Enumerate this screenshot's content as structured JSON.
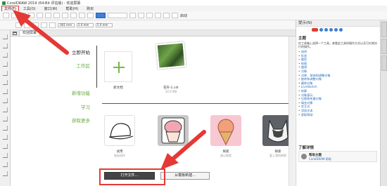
{
  "window": {
    "title": "CorelDRAW 2019 (64-Bit 评估版) - 欢迎屏幕"
  },
  "menu": {
    "file": "文件(F)",
    "tools": "工具(O)",
    "window": "窗口(W)",
    "help": "帮助(H)",
    "buy": "购买"
  },
  "toolbar": {
    "launch": "启动",
    "size1": "5.0 mm",
    "size2": "5.0 mm",
    "outline": ".001 mm"
  },
  "tabs": {
    "welcome": "欢迎屏幕"
  },
  "nav": {
    "items": [
      "立即开始",
      "工作区",
      "新增功能",
      "学习",
      "获取更多"
    ]
  },
  "recent": {
    "new_doc": "新文档",
    "file_name": "花卉-1.cdr",
    "file_size": "32.6 MB"
  },
  "templates": [
    {
      "title": "试用",
      "sub": "轻松创作"
    },
    {
      "title": "",
      "sub": ""
    },
    {
      "title": "探索",
      "sub": "甜心图案"
    },
    {
      "title": "探索",
      "sub": "爱上我的狗狗"
    }
  ],
  "buttons": {
    "open": "打开文件...",
    "new_from_template": "从模板新建..."
  },
  "panel": {
    "title": "提示(N)",
    "section": "主题",
    "desc": "在工具箱上选择一个工具，查看此工具的操作方式以及可对其执行的操作。",
    "topics": [
      "选择",
      "形状",
      "裁剪",
      "绘图",
      "曲线",
      "对象",
      "对称、装饰和调整对象",
      "旋转和调整对象",
      "删除对象",
      "LiveSketch",
      "轮廓",
      "对象基元",
      "位图和矢量对象",
      "填充对象",
      "交互式",
      "添加文本",
      "获取帮助"
    ],
    "learn_more": "了解详情",
    "help_title": "帮助主题",
    "help_sub": "CorelDRAW 帮助"
  },
  "colors": {
    "accent_green": "#74b944",
    "annotation_red": "#e53935",
    "link_blue": "#2a6ebb"
  }
}
